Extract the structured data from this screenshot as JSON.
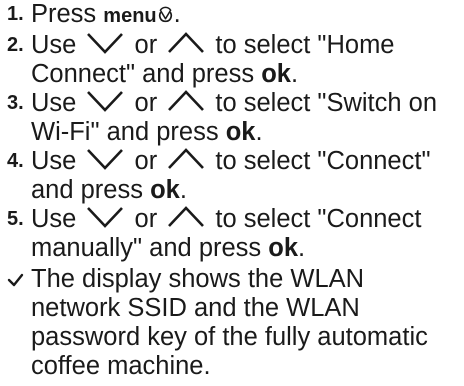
{
  "steps": [
    {
      "num": "1.",
      "pre": "Press ",
      "kw": "menu",
      "post": "."
    },
    {
      "num": "2.",
      "a": "Use ",
      "b": " or ",
      "c": " to select \"Home Connect\" and press ",
      "kw": "ok",
      "end": "."
    },
    {
      "num": "3.",
      "a": "Use ",
      "b": " or ",
      "c": " to select \"Switch on Wi-Fi\" and press ",
      "kw": "ok",
      "end": "."
    },
    {
      "num": "4.",
      "a": "Use ",
      "b": " or ",
      "c": " to select \"Connect\" and press ",
      "kw": "ok",
      "end": "."
    },
    {
      "num": "5.",
      "a": "Use ",
      "b": " or ",
      "c": " to select \"Connect manually\" and press ",
      "kw": "ok",
      "end": "."
    }
  ],
  "result": "The display shows the WLAN network SSID and the WLAN password key of the fully automatic coffee machine.",
  "icons": {
    "menu": "menu-icon",
    "down": "chevron-down-icon",
    "up": "chevron-up-icon",
    "result": "checkmark-icon"
  }
}
